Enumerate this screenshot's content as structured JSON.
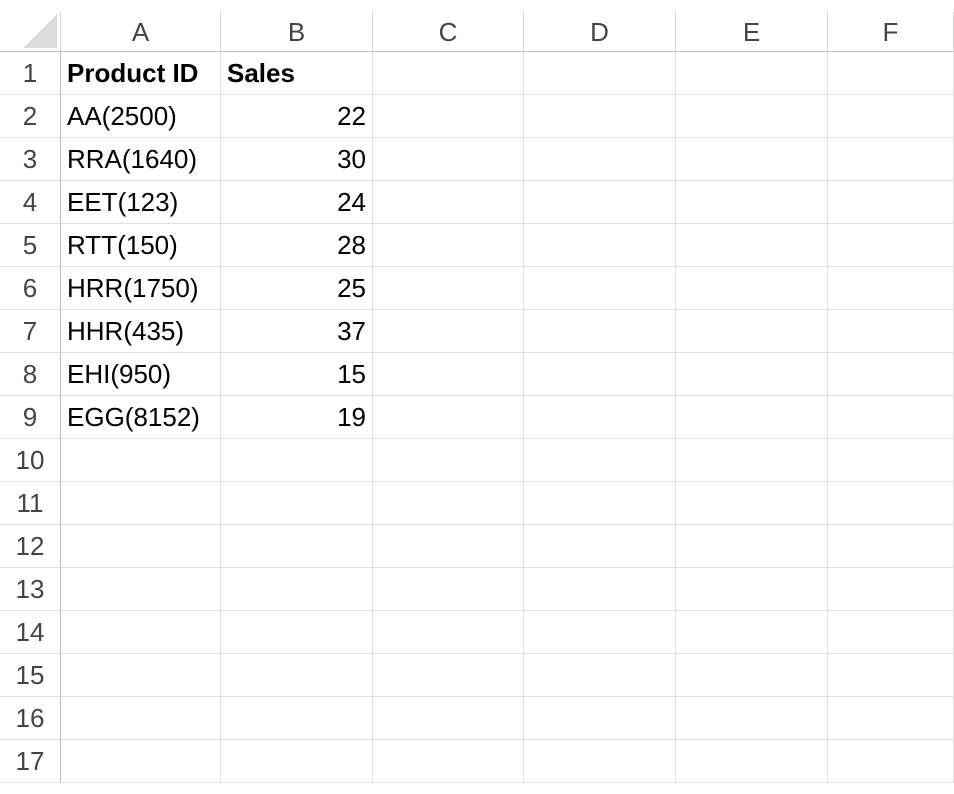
{
  "columns": [
    "A",
    "B",
    "C",
    "D",
    "E",
    "F"
  ],
  "rows": [
    "1",
    "2",
    "3",
    "4",
    "5",
    "6",
    "7",
    "8",
    "9",
    "10",
    "11",
    "12",
    "13",
    "14",
    "15",
    "16",
    "17"
  ],
  "cells": {
    "A1": "Product ID",
    "B1": "Sales",
    "A2": "AA(2500)",
    "B2": "22",
    "A3": "RRA(1640)",
    "B3": "30",
    "A4": "EET(123)",
    "B4": "24",
    "A5": "RTT(150)",
    "B5": "28",
    "A6": "HRR(1750)",
    "B6": "25",
    "A7": "HHR(435)",
    "B7": "37",
    "A8": "EHI(950)",
    "B8": "15",
    "A9": "EGG(8152)",
    "B9": "19"
  },
  "bold_cells": [
    "A1",
    "B1"
  ],
  "numeric_columns": [
    "B"
  ],
  "colors": {
    "gridline": "#e1e1e1",
    "header_text": "#444444",
    "header_border": "#bdbdbd",
    "corner_triangle": "#dcdcdc"
  }
}
